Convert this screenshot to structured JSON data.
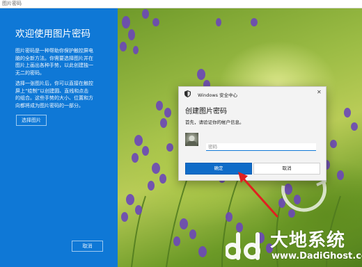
{
  "window": {
    "title": "图片密码"
  },
  "left_panel": {
    "title": "欢迎使用图片密码",
    "description_1": "图片密码是一种帮助你保护触控屏电脑的全新方法。你需要选择图片并在图片上画出各种手势，以此创建独一无二的密码。",
    "description_2": "选择一张图片后，你可以直接在触控屏上“绘制”以创建圆、直线和点击的组合。这些手势的大小、位置和方向都将成为图片密码的一部分。",
    "choose_picture_label": "选择图片",
    "cancel_label": "取消",
    "background_color": "#0f78d6"
  },
  "dialog": {
    "app_name": "Windows 安全中心",
    "title": "创建图片密码",
    "message": "首先，请验证你的帐户信息。",
    "password_placeholder": "密码",
    "password_value": "",
    "ok_label": "确定",
    "cancel_label": "取消",
    "accent_color": "#0f6cc8"
  },
  "annotation": {
    "arrow_color": "#e02020",
    "points_to": "ok-button"
  },
  "watermark": {
    "text_cn": "大地系统",
    "text_en": "www.DadiGhost.com"
  }
}
